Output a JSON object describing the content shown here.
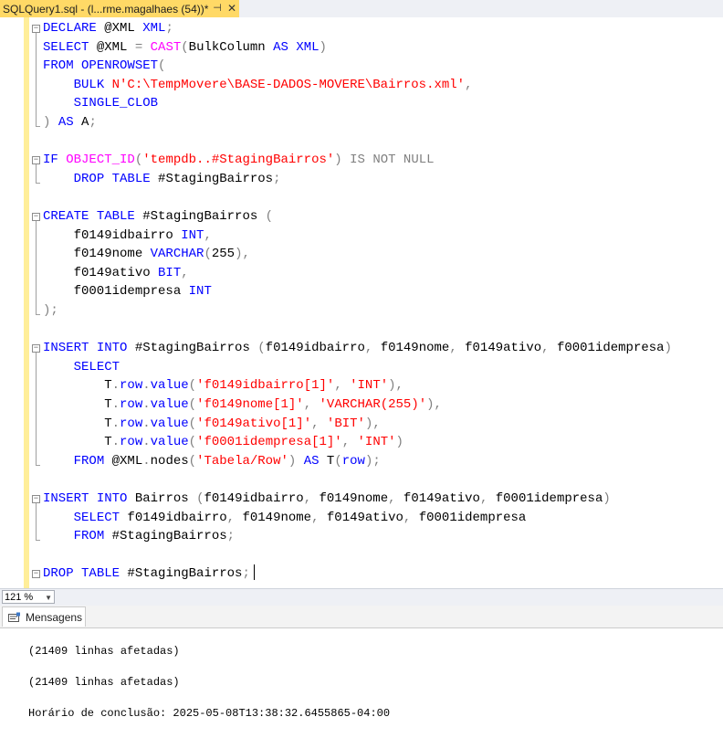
{
  "tab": {
    "title": "SQLQuery1.sql - (l...rme.magalhaes (54))*",
    "pin_glyph": "⊣",
    "close_glyph": "✕"
  },
  "editor": {
    "lines": [
      [
        [
          "kw",
          "DECLARE"
        ],
        [
          "t",
          " @XML "
        ],
        [
          "kw",
          "XML"
        ],
        [
          "gr",
          ";"
        ]
      ],
      [
        [
          "kw",
          "SELECT"
        ],
        [
          "t",
          " @XML "
        ],
        [
          "gr",
          "="
        ],
        [
          "t",
          " "
        ],
        [
          "fn",
          "CAST"
        ],
        [
          "gr",
          "("
        ],
        [
          "t",
          "BulkColumn "
        ],
        [
          "kw",
          "AS"
        ],
        [
          "t",
          " "
        ],
        [
          "kw",
          "XML"
        ],
        [
          "gr",
          ")"
        ]
      ],
      [
        [
          "kw",
          "FROM"
        ],
        [
          "t",
          " "
        ],
        [
          "kw",
          "OPENROWSET"
        ],
        [
          "gr",
          "("
        ]
      ],
      [
        [
          "t",
          "    "
        ],
        [
          "kw",
          "BULK"
        ],
        [
          "t",
          " "
        ],
        [
          "str",
          "N'C:\\TempMovere\\BASE-DADOS-MOVERE\\Bairros.xml'"
        ],
        [
          "gr",
          ","
        ]
      ],
      [
        [
          "t",
          "    "
        ],
        [
          "kw",
          "SINGLE_CLOB"
        ]
      ],
      [
        [
          "gr",
          ")"
        ],
        [
          "t",
          " "
        ],
        [
          "kw",
          "AS"
        ],
        [
          "t",
          " A"
        ],
        [
          "gr",
          ";"
        ]
      ],
      [],
      [
        [
          "kw",
          "IF"
        ],
        [
          "t",
          " "
        ],
        [
          "fn",
          "OBJECT_ID"
        ],
        [
          "gr",
          "("
        ],
        [
          "str",
          "'tempdb..#StagingBairros'"
        ],
        [
          "gr",
          ")"
        ],
        [
          "t",
          " "
        ],
        [
          "gr",
          "IS NOT NULL"
        ]
      ],
      [
        [
          "t",
          "    "
        ],
        [
          "kw",
          "DROP"
        ],
        [
          "t",
          " "
        ],
        [
          "kw",
          "TABLE"
        ],
        [
          "t",
          " #StagingBairros"
        ],
        [
          "gr",
          ";"
        ]
      ],
      [],
      [
        [
          "kw",
          "CREATE"
        ],
        [
          "t",
          " "
        ],
        [
          "kw",
          "TABLE"
        ],
        [
          "t",
          " #StagingBairros "
        ],
        [
          "gr",
          "("
        ]
      ],
      [
        [
          "t",
          "    f0149idbairro "
        ],
        [
          "kw",
          "INT"
        ],
        [
          "gr",
          ","
        ]
      ],
      [
        [
          "t",
          "    f0149nome "
        ],
        [
          "kw",
          "VARCHAR"
        ],
        [
          "gr",
          "("
        ],
        [
          "t",
          "255"
        ],
        [
          "gr",
          "),"
        ]
      ],
      [
        [
          "t",
          "    f0149ativo "
        ],
        [
          "kw",
          "BIT"
        ],
        [
          "gr",
          ","
        ]
      ],
      [
        [
          "t",
          "    f0001idempresa "
        ],
        [
          "kw",
          "INT"
        ]
      ],
      [
        [
          "gr",
          ");"
        ]
      ],
      [],
      [
        [
          "kw",
          "INSERT"
        ],
        [
          "t",
          " "
        ],
        [
          "kw",
          "INTO"
        ],
        [
          "t",
          " #StagingBairros "
        ],
        [
          "gr",
          "("
        ],
        [
          "t",
          "f0149idbairro"
        ],
        [
          "gr",
          ","
        ],
        [
          "t",
          " f0149nome"
        ],
        [
          "gr",
          ","
        ],
        [
          "t",
          " f0149ativo"
        ],
        [
          "gr",
          ","
        ],
        [
          "t",
          " f0001idempresa"
        ],
        [
          "gr",
          ")"
        ]
      ],
      [
        [
          "t",
          "    "
        ],
        [
          "kw",
          "SELECT"
        ]
      ],
      [
        [
          "t",
          "        T"
        ],
        [
          "gr",
          "."
        ],
        [
          "kw",
          "row"
        ],
        [
          "gr",
          "."
        ],
        [
          "kw",
          "value"
        ],
        [
          "gr",
          "("
        ],
        [
          "str",
          "'f0149idbairro[1]'"
        ],
        [
          "gr",
          ","
        ],
        [
          "t",
          " "
        ],
        [
          "str",
          "'INT'"
        ],
        [
          "gr",
          "),"
        ]
      ],
      [
        [
          "t",
          "        T"
        ],
        [
          "gr",
          "."
        ],
        [
          "kw",
          "row"
        ],
        [
          "gr",
          "."
        ],
        [
          "kw",
          "value"
        ],
        [
          "gr",
          "("
        ],
        [
          "str",
          "'f0149nome[1]'"
        ],
        [
          "gr",
          ","
        ],
        [
          "t",
          " "
        ],
        [
          "str",
          "'VARCHAR(255)'"
        ],
        [
          "gr",
          "),"
        ]
      ],
      [
        [
          "t",
          "        T"
        ],
        [
          "gr",
          "."
        ],
        [
          "kw",
          "row"
        ],
        [
          "gr",
          "."
        ],
        [
          "kw",
          "value"
        ],
        [
          "gr",
          "("
        ],
        [
          "str",
          "'f0149ativo[1]'"
        ],
        [
          "gr",
          ","
        ],
        [
          "t",
          " "
        ],
        [
          "str",
          "'BIT'"
        ],
        [
          "gr",
          "),"
        ]
      ],
      [
        [
          "t",
          "        T"
        ],
        [
          "gr",
          "."
        ],
        [
          "kw",
          "row"
        ],
        [
          "gr",
          "."
        ],
        [
          "kw",
          "value"
        ],
        [
          "gr",
          "("
        ],
        [
          "str",
          "'f0001idempresa[1]'"
        ],
        [
          "gr",
          ","
        ],
        [
          "t",
          " "
        ],
        [
          "str",
          "'INT'"
        ],
        [
          "gr",
          ")"
        ]
      ],
      [
        [
          "t",
          "    "
        ],
        [
          "kw",
          "FROM"
        ],
        [
          "t",
          " @XML"
        ],
        [
          "gr",
          "."
        ],
        [
          "t",
          "nodes"
        ],
        [
          "gr",
          "("
        ],
        [
          "str",
          "'Tabela/Row'"
        ],
        [
          "gr",
          ")"
        ],
        [
          "t",
          " "
        ],
        [
          "kw",
          "AS"
        ],
        [
          "t",
          " T"
        ],
        [
          "gr",
          "("
        ],
        [
          "kw",
          "row"
        ],
        [
          "gr",
          ");"
        ]
      ],
      [],
      [
        [
          "kw",
          "INSERT"
        ],
        [
          "t",
          " "
        ],
        [
          "kw",
          "INTO"
        ],
        [
          "t",
          " Bairros "
        ],
        [
          "gr",
          "("
        ],
        [
          "t",
          "f0149idbairro"
        ],
        [
          "gr",
          ","
        ],
        [
          "t",
          " f0149nome"
        ],
        [
          "gr",
          ","
        ],
        [
          "t",
          " f0149ativo"
        ],
        [
          "gr",
          ","
        ],
        [
          "t",
          " f0001idempresa"
        ],
        [
          "gr",
          ")"
        ]
      ],
      [
        [
          "t",
          "    "
        ],
        [
          "kw",
          "SELECT"
        ],
        [
          "t",
          " f0149idbairro"
        ],
        [
          "gr",
          ","
        ],
        [
          "t",
          " f0149nome"
        ],
        [
          "gr",
          ","
        ],
        [
          "t",
          " f0149ativo"
        ],
        [
          "gr",
          ","
        ],
        [
          "t",
          " f0001idempresa"
        ]
      ],
      [
        [
          "t",
          "    "
        ],
        [
          "kw",
          "FROM"
        ],
        [
          "t",
          " #StagingBairros"
        ],
        [
          "gr",
          ";"
        ]
      ],
      [],
      [
        [
          "kw",
          "DROP"
        ],
        [
          "t",
          " "
        ],
        [
          "kw",
          "TABLE"
        ],
        [
          "t",
          " #StagingBairros"
        ],
        [
          "gr",
          ";"
        ]
      ]
    ]
  },
  "statusbar": {
    "zoom": "121 %"
  },
  "results": {
    "tab_label": "Mensagens",
    "messages": [
      "(21409 linhas afetadas)",
      "(21409 linhas afetadas)",
      "Horário de conclusão: 2025-05-08T13:38:32.6455865-04:00"
    ]
  }
}
